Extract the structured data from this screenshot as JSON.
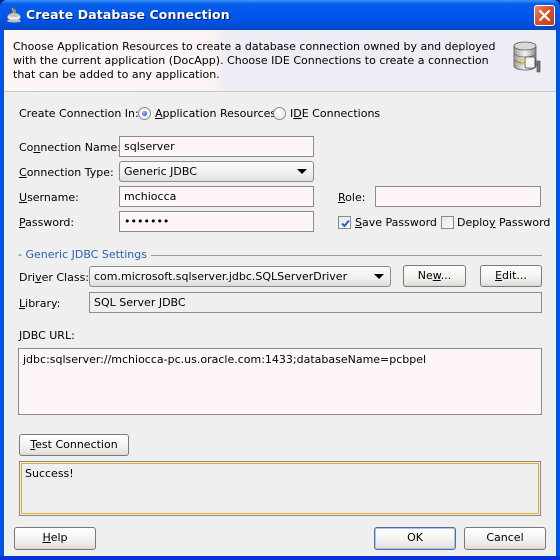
{
  "window": {
    "title": "Create Database Connection",
    "title_icon": "java-cup-icon",
    "close_icon": "close-icon"
  },
  "header": {
    "description": "Choose Application Resources to create a database connection owned by and deployed with the current application (DocApp). Choose IDE Connections to create a connection that can be added to any application.",
    "icon": "database-connection-icon"
  },
  "create_in": {
    "label": "Create Connection In:",
    "options": [
      {
        "label_pre": "",
        "mnemonic": "A",
        "label_post": "pplication Resources",
        "selected": true
      },
      {
        "label_pre": "I",
        "mnemonic": "D",
        "label_post": "E Connections",
        "selected": false
      }
    ]
  },
  "form": {
    "connection_name": {
      "label_pre": "Co",
      "mnemonic": "n",
      "label_post": "nection Name:",
      "value": "sqlserver"
    },
    "connection_type": {
      "label_pre": "",
      "mnemonic": "C",
      "label_post": "onnection Type:",
      "value": "Generic JDBC"
    },
    "username": {
      "label_pre": "",
      "mnemonic": "U",
      "label_post": "sername:",
      "value": "mchiocca"
    },
    "password": {
      "label_pre": "",
      "mnemonic": "P",
      "label_post": "assword:",
      "value": "•••••••"
    },
    "role": {
      "label_pre": "",
      "mnemonic": "R",
      "label_post": "ole:",
      "value": ""
    },
    "save_password": {
      "label_pre": "",
      "mnemonic": "S",
      "label_post": "ave Password",
      "checked": true
    },
    "deploy_password": {
      "label_pre": "Deplo",
      "mnemonic": "y",
      "label_post": " Password",
      "checked": false
    }
  },
  "jdbc_settings": {
    "section_title": "- Generic JDBC Settings",
    "driver_class": {
      "label_pre": "Dri",
      "mnemonic": "v",
      "label_post": "er Class:",
      "value": "com.microsoft.sqlserver.jdbc.SQLServerDriver"
    },
    "new_button": {
      "label_pre": "Ne",
      "mnemonic": "w",
      "label_post": "..."
    },
    "edit_button": {
      "label_pre": "",
      "mnemonic": "E",
      "label_post": "dit..."
    },
    "library": {
      "label_pre": "",
      "mnemonic": "L",
      "label_post": "ibrary:",
      "value": "SQL Server JDBC"
    },
    "jdbc_url": {
      "label_pre": "",
      "mnemonic": "J",
      "label_post": "DBC URL:",
      "value": "jdbc:sqlserver://mchiocca-pc.us.oracle.com:1433;databaseName=pcbpel"
    }
  },
  "test": {
    "button": {
      "label_pre": "",
      "mnemonic": "T",
      "label_post": "est Connection"
    },
    "status": "Success!"
  },
  "footer": {
    "help": {
      "label_pre": "",
      "mnemonic": "H",
      "label_post": "elp"
    },
    "ok": "OK",
    "cancel": "Cancel"
  },
  "colors": {
    "titlebar": "#0054e3",
    "field_bg": "#fdf5f6",
    "section_title": "#2b5fb4",
    "status_border": "#f0a81e"
  }
}
